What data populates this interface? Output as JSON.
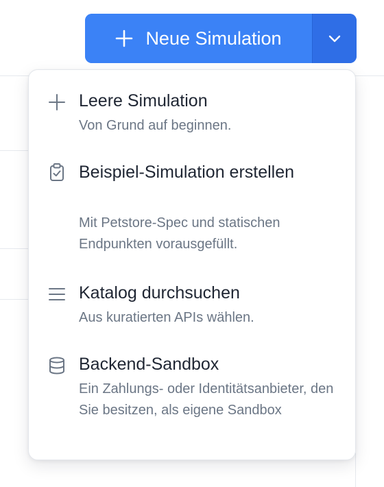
{
  "button": {
    "main_label": "Neue Simulation",
    "plus_icon": "plus-icon",
    "dropdown_icon": "chevron-down-icon",
    "color": "#3b82f6"
  },
  "menu": {
    "items": [
      {
        "title": "Leere Simulation",
        "description": "Von Grund auf beginnen.",
        "icon": "plus-icon"
      },
      {
        "title": "Beispiel-Simulation erstellen",
        "description": "Mit Petstore-Spec und statischen Endpunkten vorausgefüllt.",
        "icon": "clipboard-check-icon"
      },
      {
        "title": "Katalog durchsuchen",
        "description": "Aus kuratierten APIs wählen.",
        "icon": "menu-lines-icon"
      },
      {
        "title": "Backend-Sandbox",
        "description": "Ein Zahlungs- oder Identitätsanbieter, den Sie besitzen, als eigene Sandbox",
        "icon": "database-icon"
      }
    ]
  }
}
